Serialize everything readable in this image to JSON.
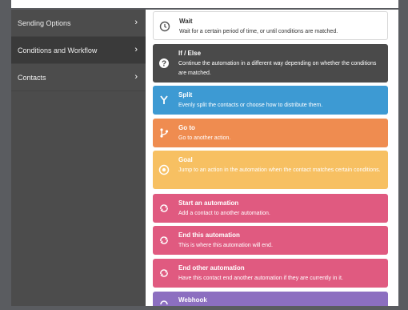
{
  "sidebar": {
    "items": [
      {
        "label": "Sending Options"
      },
      {
        "label": "Conditions and Workflow"
      },
      {
        "label": "Contacts"
      }
    ]
  },
  "actions": [
    {
      "title": "Wait",
      "desc": "Wait for a certain period of time, or until conditions are matched.",
      "color": "#ffffff",
      "icon": "clock-icon"
    },
    {
      "title": "If / Else",
      "desc": "Continue the automation in a different way depending on whether the conditions are matched.",
      "color": "#4a4a4a",
      "icon": "question-icon"
    },
    {
      "title": "Split",
      "desc": "Evenly split the contacts or choose how to distribute them.",
      "color": "#3d9ad3",
      "icon": "split-icon"
    },
    {
      "title": "Go to",
      "desc": "Go to another action.",
      "color": "#ef8c50",
      "icon": "goto-icon"
    },
    {
      "title": "Goal",
      "desc": "Jump to an action in the automation when the contact matches certain conditions.",
      "color": "#f7c062",
      "icon": "target-icon"
    },
    {
      "title": "Start an automation",
      "desc": "Add a contact to another automation.",
      "color": "#e05a80",
      "icon": "automation-icon"
    },
    {
      "title": "End this automation",
      "desc": "This is where this automation will end.",
      "color": "#e05a80",
      "icon": "automation-icon"
    },
    {
      "title": "End other automation",
      "desc": "Have this contact end another automation if they are currently in it.",
      "color": "#e05a80",
      "icon": "automation-icon"
    },
    {
      "title": "Webhook",
      "desc": "",
      "color": "#8c6fc0",
      "icon": "webhook-icon"
    }
  ]
}
